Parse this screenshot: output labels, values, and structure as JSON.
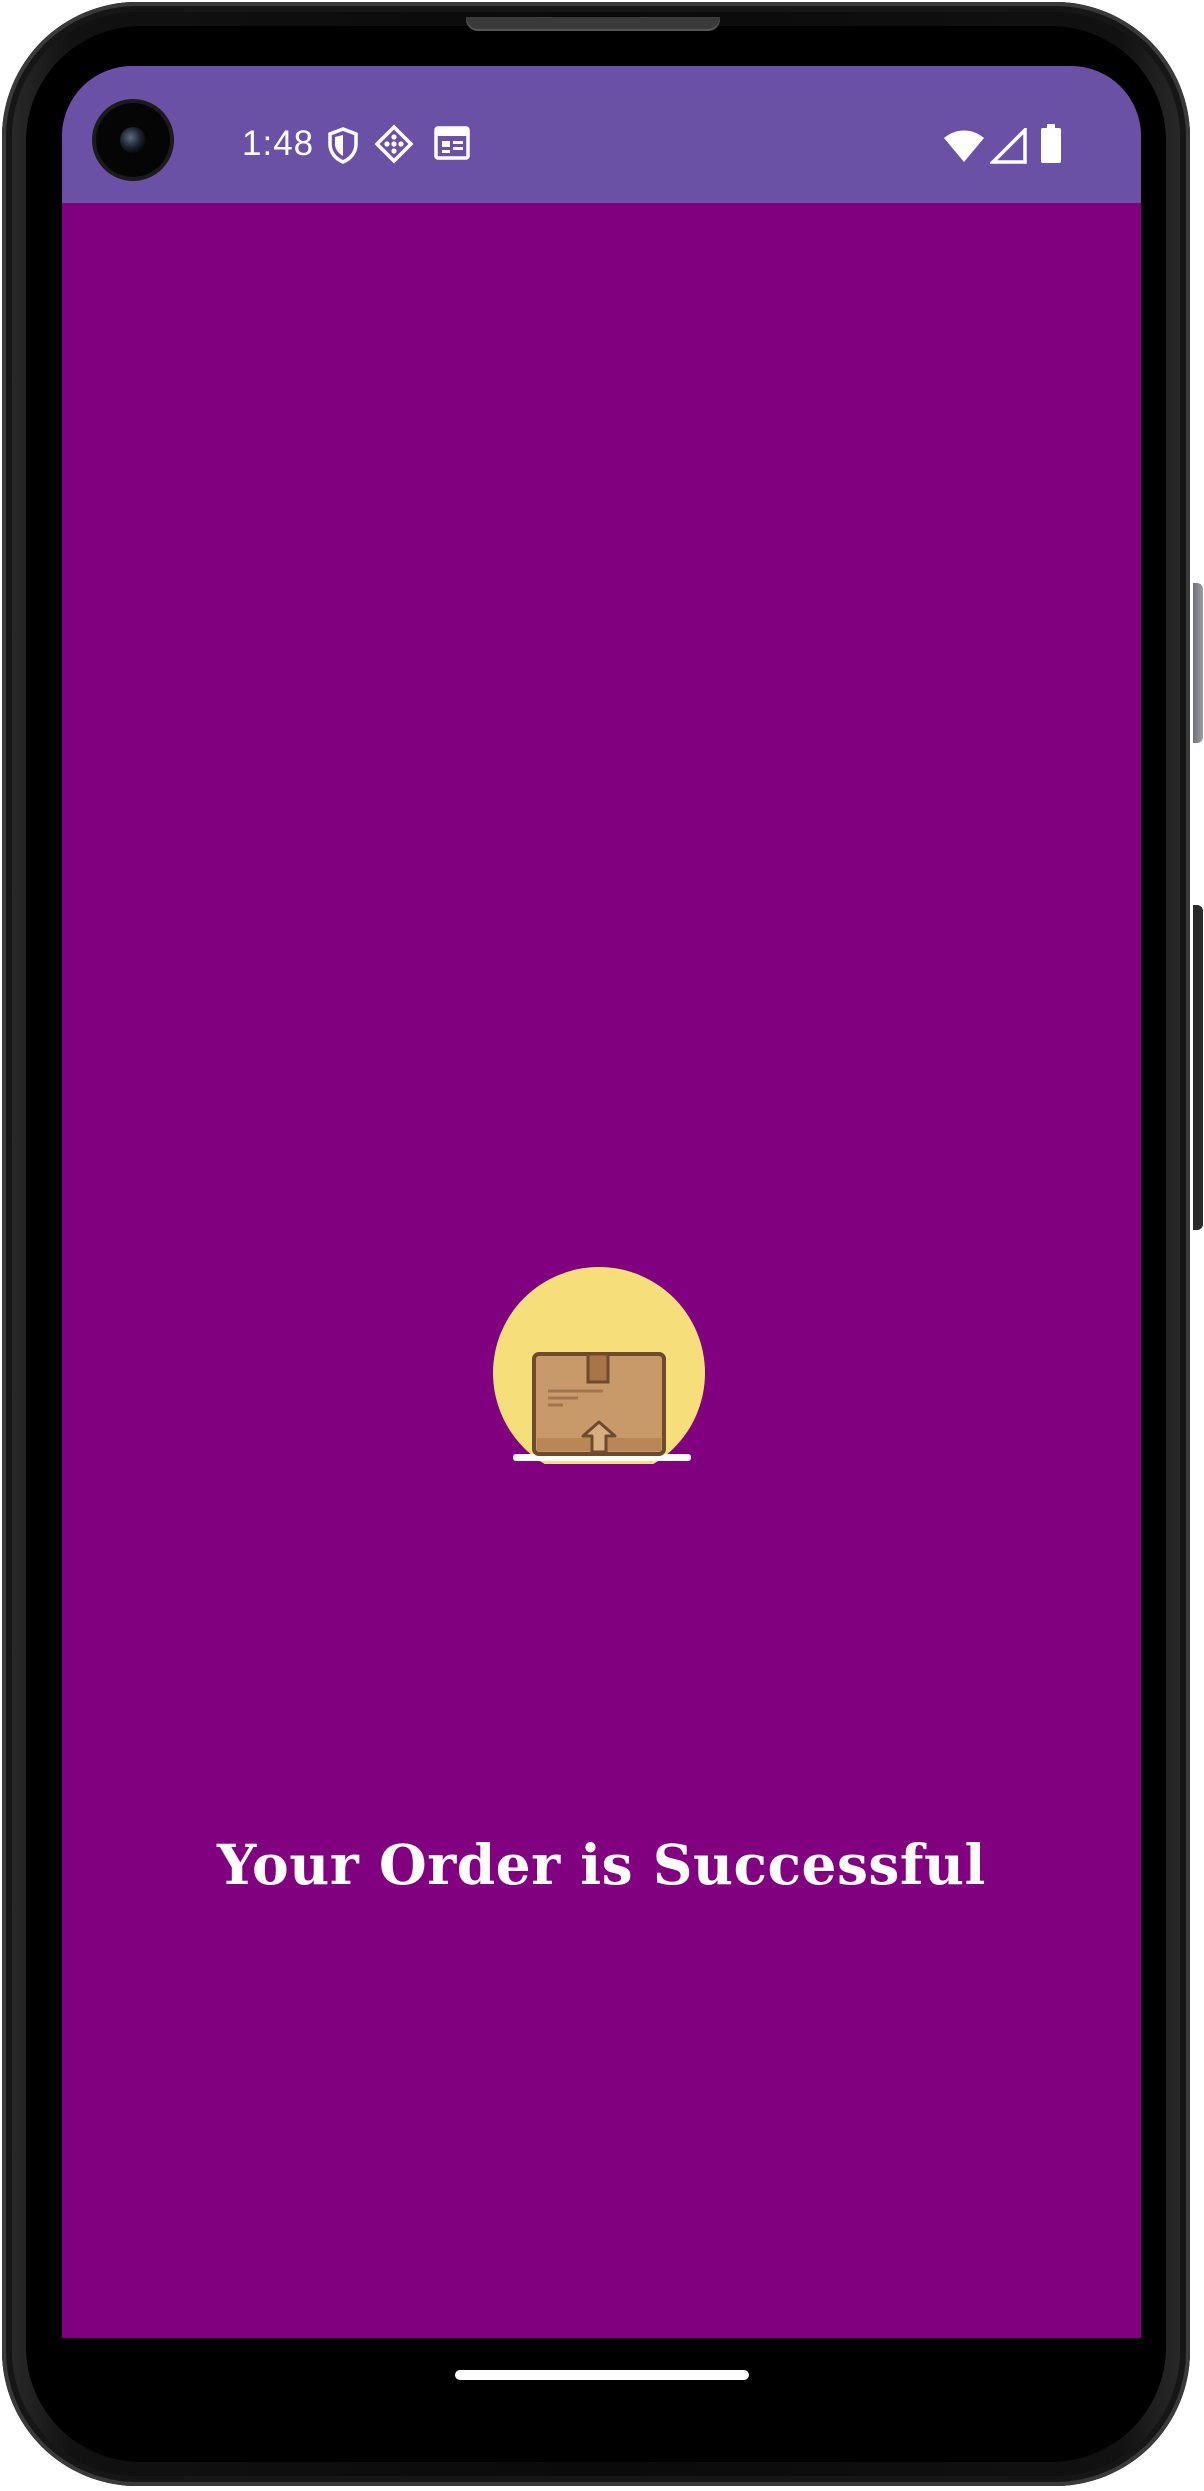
{
  "status_bar": {
    "time": "1:48",
    "background_color": "#6a51a6",
    "left_icons": [
      "shield-icon",
      "game-icon",
      "calendar-icon"
    ],
    "right_icons": [
      "wifi-icon",
      "cellular-signal-icon",
      "battery-icon"
    ]
  },
  "screen": {
    "background_color": "#800080",
    "illustration": "package-box-icon",
    "message": "Your Order is Successful"
  },
  "navigation": {
    "home_indicator": "home-gesture-bar"
  }
}
